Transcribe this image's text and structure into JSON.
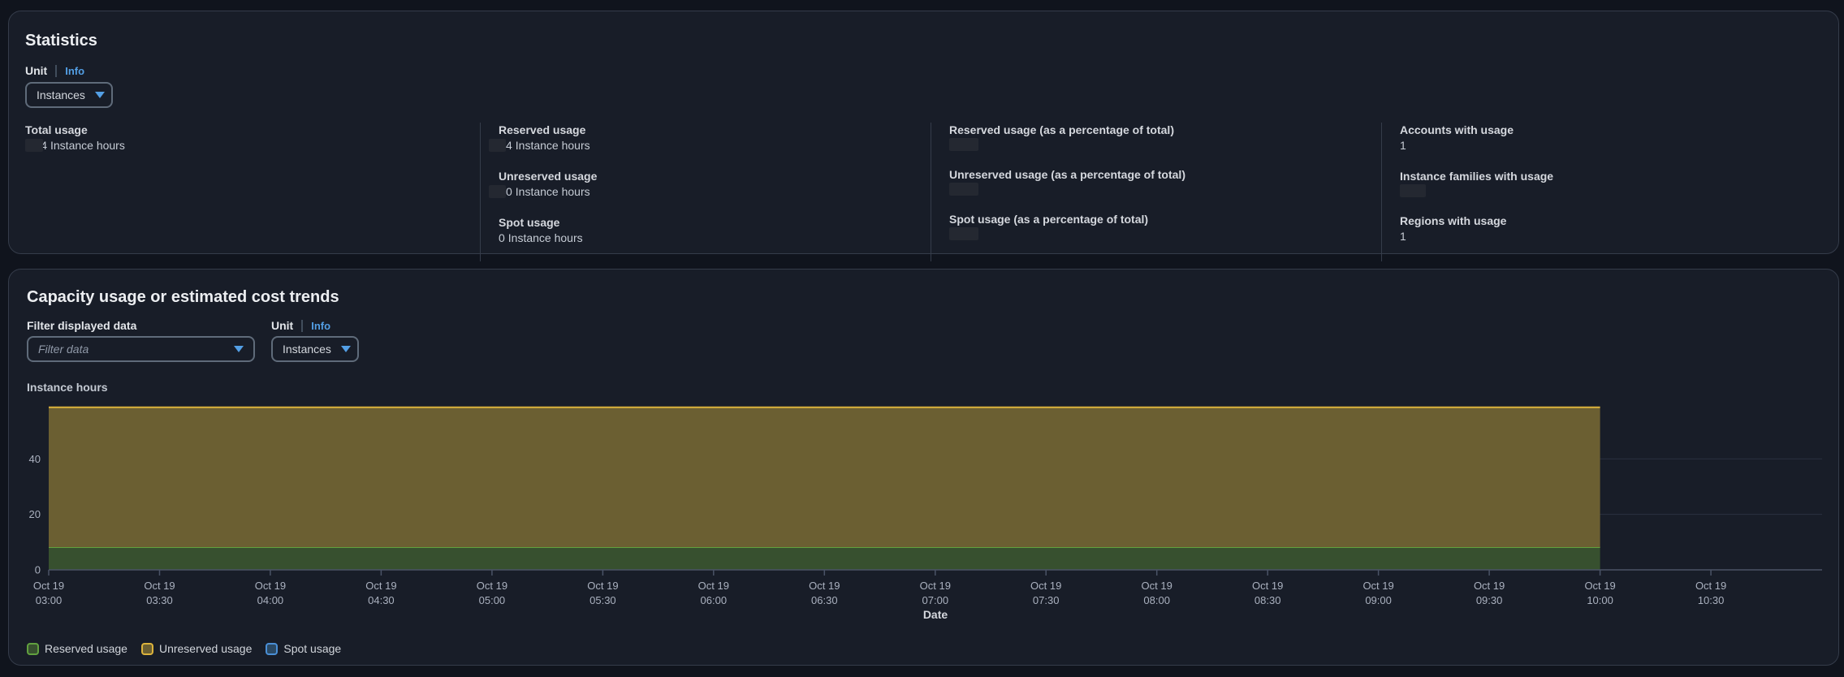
{
  "statistics_panel": {
    "title": "Statistics",
    "unit_label": "Unit",
    "info_label": "Info",
    "unit_select_value": "Instances"
  },
  "stats": {
    "columns": [
      {
        "items": [
          {
            "label": "Total usage",
            "digit": "4",
            "value": "Instance hours",
            "redacted": true
          }
        ]
      },
      {
        "items": [
          {
            "label": "Reserved usage",
            "digit": "4",
            "value": "Instance hours",
            "redacted": true
          },
          {
            "label": "Unreserved usage",
            "digit": "0",
            "value": "Instance hours",
            "redacted": true
          },
          {
            "label": "Spot usage",
            "digit": "0",
            "value": "Instance hours",
            "redacted": false
          }
        ]
      },
      {
        "items": [
          {
            "label": "Reserved usage (as a percentage of total)",
            "value": "",
            "redacted": true
          },
          {
            "label": "Unreserved usage (as a percentage of total)",
            "value": "",
            "redacted": true
          },
          {
            "label": "Spot usage (as a percentage of total)",
            "value": "",
            "redacted": true
          }
        ]
      },
      {
        "items": [
          {
            "label": "Accounts with usage",
            "value": "1",
            "redacted": false
          },
          {
            "label": "Instance families with usage",
            "value": "",
            "redacted": true
          },
          {
            "label": "Regions with usage",
            "value": "1",
            "redacted": false
          }
        ]
      }
    ]
  },
  "trends_panel": {
    "title": "Capacity usage or estimated cost trends",
    "filter_label": "Filter displayed data",
    "filter_placeholder": "Filter data",
    "unit_label": "Unit",
    "info_label": "Info",
    "unit_select_value": "Instances",
    "chart_title": "Instance hours"
  },
  "chart_data": {
    "type": "area",
    "stacked": true,
    "title": "Instance hours",
    "xlabel": "Date",
    "ylabel": "Instance hours",
    "grid": true,
    "legend_position": "bottom",
    "y_ticks": [
      0,
      20,
      40
    ],
    "ylim": [
      0,
      59.4
    ],
    "x": [
      "Oct 19 03:00",
      "Oct 19 03:30",
      "Oct 19 04:00",
      "Oct 19 04:30",
      "Oct 19 05:00",
      "Oct 19 05:30",
      "Oct 19 06:00",
      "Oct 19 06:30",
      "Oct 19 07:00",
      "Oct 19 07:30",
      "Oct 19 08:00",
      "Oct 19 08:30",
      "Oct 19 09:00",
      "Oct 19 09:30",
      "Oct 19 10:00",
      "Oct 19 10:30"
    ],
    "series": [
      {
        "name": "Reserved usage",
        "color": "#61a13f",
        "fill": "#37502f",
        "values": [
          8.2,
          8.2,
          8.2,
          8.2,
          8.2,
          8.2,
          8.2,
          8.2,
          8.2,
          8.2,
          8.2,
          8.2,
          8.2,
          8.2,
          8.2
        ]
      },
      {
        "name": "Unreserved usage",
        "color": "#dcb33c",
        "fill": "#6b5f32",
        "values": [
          50.4,
          50.4,
          50.4,
          50.4,
          50.4,
          50.4,
          50.4,
          50.4,
          50.4,
          50.4,
          50.4,
          50.4,
          50.4,
          50.4,
          50.4
        ]
      },
      {
        "name": "Spot usage",
        "color": "#4a8fd6",
        "fill": "#2b4964",
        "values": [
          0,
          0,
          0,
          0,
          0,
          0,
          0,
          0,
          0,
          0,
          0,
          0,
          0,
          0,
          0
        ]
      }
    ]
  }
}
